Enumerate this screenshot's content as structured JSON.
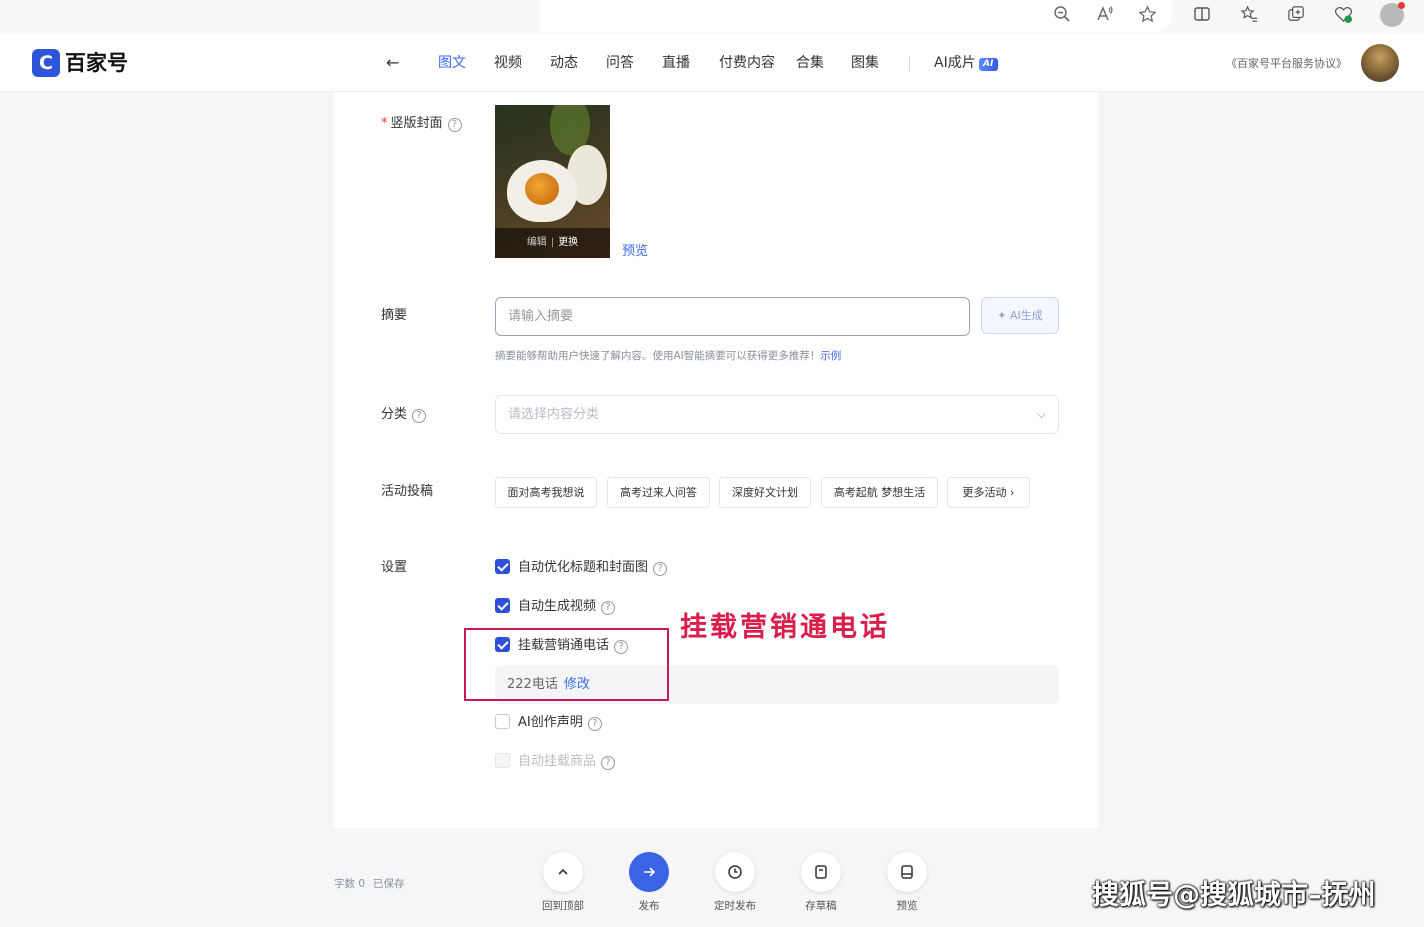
{
  "browser_toolbar": {
    "icons": [
      "zoom-out-icon",
      "read-aloud-icon",
      "favorite-star-icon",
      "split-screen-icon",
      "favorites-list-icon",
      "collections-icon",
      "browser-essentials-icon",
      "profile-icon"
    ]
  },
  "header": {
    "logo_mark": "C",
    "logo_text": "百家号",
    "back_glyph": "←",
    "nav": [
      {
        "label": "图文",
        "active": true
      },
      {
        "label": "视频"
      },
      {
        "label": "动态"
      },
      {
        "label": "问答"
      },
      {
        "label": "直播"
      },
      {
        "label": "付费内容"
      },
      {
        "label": "合集"
      },
      {
        "label": "图集"
      }
    ],
    "ai_nav_label": "AI成片",
    "ai_badge": "AI",
    "agreement": "《百家号平台服务协议》",
    "accent_color": "#3a6af0"
  },
  "form": {
    "cover": {
      "label": "竖版封面",
      "required_mark": "*",
      "edit_label": "编辑",
      "bar_sep": "|",
      "replace_label": "更换",
      "preview_label": "预览"
    },
    "summary": {
      "label": "摘要",
      "placeholder": "请输入摘要",
      "ai_button": "AI生成",
      "hint": "摘要能够帮助用户快速了解内容。使用AI智能摘要可以获得更多推荐！",
      "example_link": "示例"
    },
    "category": {
      "label": "分类",
      "placeholder": "请选择内容分类"
    },
    "activity": {
      "label": "活动投稿",
      "tags": [
        "面对高考我想说",
        "高考过来人问答",
        "深度好文计划",
        "高考起航 梦想生活",
        "更多活动 ›"
      ]
    },
    "settings": {
      "label": "设置",
      "items": [
        {
          "label": "自动优化标题和封面图",
          "checked": true
        },
        {
          "label": "自动生成视频",
          "checked": true
        },
        {
          "label": "挂载营销通电话",
          "checked": true
        },
        {
          "label": "AI创作声明",
          "checked": false
        },
        {
          "label": "自动挂载商品",
          "checked": false,
          "disabled": true
        }
      ],
      "phone_value": "222电话",
      "phone_edit": "修改"
    }
  },
  "annotation": {
    "text": "挂载营销通电话",
    "color": "#d91e4b"
  },
  "footer": {
    "word_count": "字数 0",
    "saved_status": "已保存",
    "actions": [
      {
        "label": "回到顶部",
        "icon": "chevron-up-icon"
      },
      {
        "label": "发布",
        "icon": "arrow-right-icon"
      },
      {
        "label": "定时发布",
        "icon": "clock-icon"
      },
      {
        "label": "存草稿",
        "icon": "draft-icon"
      },
      {
        "label": "预览",
        "icon": "preview-device-icon"
      }
    ]
  },
  "watermark": "搜狐号@搜狐城市–抚州"
}
